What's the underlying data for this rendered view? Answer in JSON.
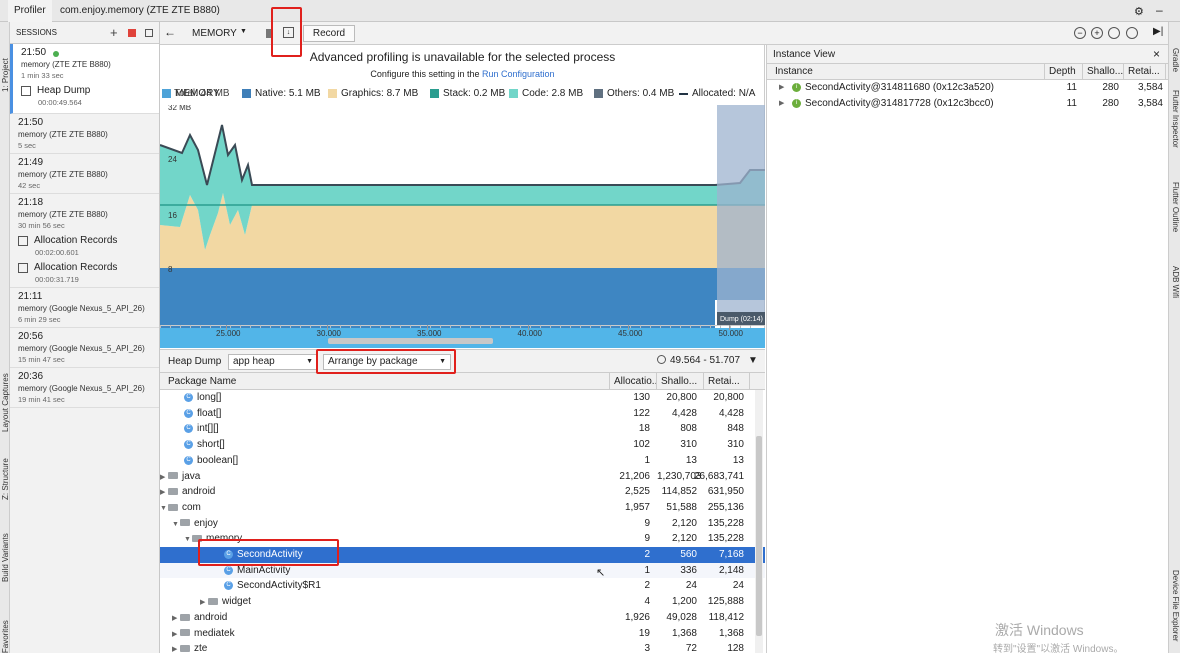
{
  "tabs": {
    "profiler": "Profiler",
    "process": "com.enjoy.memory (ZTE ZTE B880)"
  },
  "left_tools": [
    "1: Project",
    "Layout Captures",
    "Z: Structure",
    "Build Variants",
    "2: Favorites"
  ],
  "right_tools": [
    "Gradle",
    "Flutter Inspector",
    "Flutter Outline",
    "ADB Wifi",
    "Device File Explorer"
  ],
  "sessions": {
    "header": "SESSIONS",
    "items": [
      {
        "time": "21:50",
        "device": "memory (ZTE ZTE B880)",
        "duration": "1 min 33 sec",
        "artifacts": [
          {
            "label": "Heap Dump",
            "time": "00:00:49.564"
          }
        ]
      },
      {
        "time": "21:50",
        "device": "memory (ZTE ZTE B880)",
        "duration": "5 sec",
        "artifacts": []
      },
      {
        "time": "21:49",
        "device": "memory (ZTE ZTE B880)",
        "duration": "42 sec",
        "artifacts": []
      },
      {
        "time": "21:18",
        "device": "memory (ZTE ZTE B880)",
        "duration": "30 min 56 sec",
        "artifacts": [
          {
            "label": "Allocation Records",
            "time": "00:02:00.601"
          },
          {
            "label": "Allocation Records",
            "time": "00:00:31.719"
          }
        ]
      },
      {
        "time": "21:11",
        "device": "memory (Google Nexus_5_API_26)",
        "duration": "6 min 29 sec",
        "artifacts": []
      },
      {
        "time": "20:56",
        "device": "memory (Google Nexus_5_API_26)",
        "duration": "15 min 47 sec",
        "artifacts": []
      },
      {
        "time": "20:36",
        "device": "memory (Google Nexus_5_API_26)",
        "duration": "19 min 41 sec",
        "artifacts": []
      }
    ]
  },
  "toolbar": {
    "memory": "MEMORY",
    "record": "Record"
  },
  "notice": {
    "title": "Advanced profiling is unavailable for the selected process",
    "sub_prefix": "Configure this setting in the",
    "sub_link": "Run Configuration"
  },
  "legend": {
    "memory": "MEMORY",
    "total": "Total: 44 MB",
    "items": [
      {
        "label": "Native: 5.1 MB",
        "color": "#3f7fb8"
      },
      {
        "label": "Graphics: 8.7 MB",
        "color": "#f2d8a3"
      },
      {
        "label": "Stack: 0.2 MB",
        "color": "#2a9d8f"
      },
      {
        "label": "Code: 2.8 MB",
        "color": "#72d6c9"
      },
      {
        "label": "Others: 0.4 MB",
        "color": "#607080"
      },
      {
        "label": "Allocated: N/A",
        "color": "#223344"
      }
    ]
  },
  "chart_data": {
    "type": "area",
    "yticks": [
      "32 MB",
      "24",
      "16",
      "8"
    ],
    "xticks": [
      "25.000",
      "30.000",
      "35.000",
      "40.000",
      "45.000",
      "50.000"
    ],
    "dump_label": "Dump (02:14)",
    "series": [
      {
        "name": "Others: 0.4 MB",
        "values": [
          0.4,
          0.4,
          0.4,
          0.4
        ]
      },
      {
        "name": "Native: 5.1 MB",
        "values": [
          5.1,
          5.1,
          5.1,
          5.1
        ]
      },
      {
        "name": "Graphics: 8.7 MB",
        "values": [
          8.7,
          8.7,
          8.7,
          8.7
        ]
      },
      {
        "name": "Stack: 0.2 MB",
        "values": [
          0.2,
          0.2,
          0.2,
          0.2
        ]
      },
      {
        "name": "Code: 2.8 MB",
        "values": [
          2.8,
          2.8,
          2.8,
          2.8
        ]
      }
    ]
  },
  "heap": {
    "label": "Heap Dump",
    "heap_select": "app heap",
    "arrange_select": "Arrange by package",
    "range": "49.564 - 51.707",
    "columns": [
      "Package Name",
      "Allocatio...",
      "Shallo...",
      "Retai..."
    ],
    "rows": [
      {
        "name": "long[]",
        "alloc": "130",
        "shallow": "20,800",
        "retained": "20,800"
      },
      {
        "name": "float[]",
        "alloc": "122",
        "shallow": "4,428",
        "retained": "4,428"
      },
      {
        "name": "int[][]",
        "alloc": "18",
        "shallow": "808",
        "retained": "848"
      },
      {
        "name": "short[]",
        "alloc": "102",
        "shallow": "310",
        "retained": "310"
      },
      {
        "name": "boolean[]",
        "alloc": "1",
        "shallow": "13",
        "retained": "13"
      },
      {
        "name": "java",
        "alloc": "21,206",
        "shallow": "1,230,703",
        "retained": "26,683,741"
      },
      {
        "name": "android",
        "alloc": "2,525",
        "shallow": "114,852",
        "retained": "631,950"
      },
      {
        "name": "com",
        "alloc": "1,957",
        "shallow": "51,588",
        "retained": "255,136"
      },
      {
        "name": "enjoy",
        "alloc": "9",
        "shallow": "2,120",
        "retained": "135,228"
      },
      {
        "name": "memory",
        "alloc": "9",
        "shallow": "2,120",
        "retained": "135,228"
      },
      {
        "name": "SecondActivity",
        "alloc": "2",
        "shallow": "560",
        "retained": "7,168"
      },
      {
        "name": "MainActivity",
        "alloc": "1",
        "shallow": "336",
        "retained": "2,148"
      },
      {
        "name": "SecondActivity$R1",
        "alloc": "2",
        "shallow": "24",
        "retained": "24"
      },
      {
        "name": "widget",
        "alloc": "4",
        "shallow": "1,200",
        "retained": "125,888"
      },
      {
        "name": "android",
        "alloc": "1,926",
        "shallow": "49,028",
        "retained": "118,412"
      },
      {
        "name": "mediatek",
        "alloc": "19",
        "shallow": "1,368",
        "retained": "1,368"
      },
      {
        "name": "zte",
        "alloc": "3",
        "shallow": "72",
        "retained": "128"
      }
    ]
  },
  "instance": {
    "title": "Instance View",
    "columns": [
      "Instance",
      "Depth",
      "Shallo...",
      "Retai..."
    ],
    "rows": [
      {
        "name": "SecondActivity@314811680 (0x12c3a520)",
        "depth": "11",
        "shallow": "280",
        "retained": "3,584"
      },
      {
        "name": "SecondActivity@314817728 (0x12c3bcc0)",
        "depth": "11",
        "shallow": "280",
        "retained": "3,584"
      }
    ]
  },
  "watermark": {
    "line1": "激活 Windows",
    "line2": "转到\"设置\"以激活 Windows。"
  }
}
